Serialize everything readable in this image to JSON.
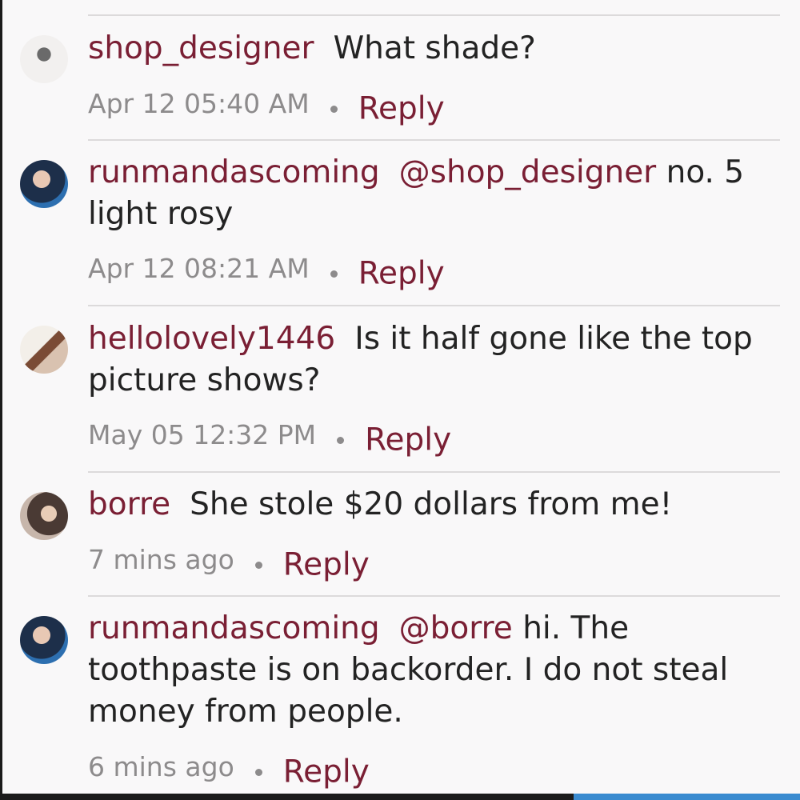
{
  "comments": [
    {
      "username": "shop_designer",
      "mention": "",
      "text": "What shade?",
      "time": "Apr 12 05:40 AM",
      "reply_label": "Reply"
    },
    {
      "username": "runmandascoming",
      "mention": "@shop_designer",
      "text": "no. 5 light rosy",
      "time": "Apr 12 08:21 AM",
      "reply_label": "Reply"
    },
    {
      "username": "hellolovely1446",
      "mention": "",
      "text": "Is it half gone like the top picture shows?",
      "time": "May 05 12:32 PM",
      "reply_label": "Reply"
    },
    {
      "username": "borre",
      "mention": "",
      "text": "She stole $20 dollars from me!",
      "time": "7 mins ago",
      "reply_label": "Reply"
    },
    {
      "username": "runmandascoming",
      "mention": "@borre",
      "text": "hi. The toothpaste is on backorder. I do not steal money from people.",
      "time": "6 mins ago",
      "reply_label": "Reply"
    }
  ],
  "colors": {
    "username": "#7a1f34",
    "text": "#232323",
    "meta": "#8d8b8c",
    "background": "#f9f8f9",
    "progress": "#3a8bd0"
  }
}
